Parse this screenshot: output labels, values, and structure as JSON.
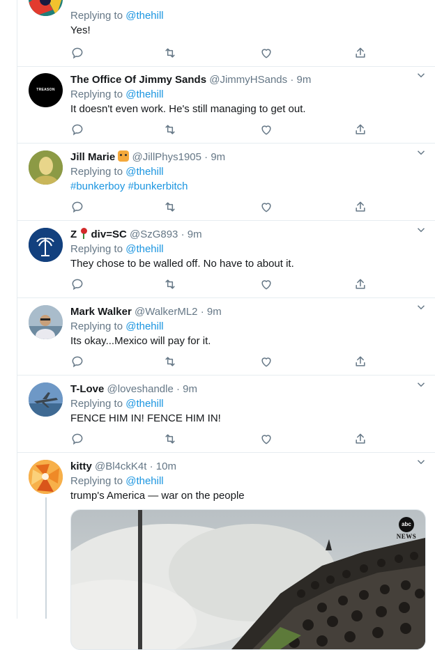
{
  "reply_prefix": "Replying to",
  "tweets": [
    {
      "name": "",
      "handle": "",
      "time": "",
      "mention": "@thehill",
      "text": "Yes!"
    },
    {
      "name": "The Office Of Jimmy Sands",
      "handle": "@JimmyHSands",
      "sep": "·",
      "time": "9m",
      "mention": "@thehill",
      "text": "It doesn't even work.  He's still managing to get out.",
      "avatar_text": "TREASON"
    },
    {
      "name": "Jill Marie",
      "handle": "@JillPhys1905",
      "sep": "·",
      "time": "9m",
      "mention": "@thehill",
      "hashtags": [
        "#bunkerboy",
        "#bunkerbitch"
      ]
    },
    {
      "name_prefix": "Z",
      "name_suffix": "div=SC",
      "handle": "@SzG893",
      "sep": "·",
      "time": "9m",
      "mention": "@thehill",
      "text": "They chose to be walled off. No have to about it."
    },
    {
      "name": "Mark Walker",
      "handle": "@WalkerML2",
      "sep": "·",
      "time": "9m",
      "mention": "@thehill",
      "text": "Its okay...Mexico will pay for it."
    },
    {
      "name": "T-Love",
      "handle": "@loveshandle",
      "sep": "·",
      "time": "9m",
      "mention": "@thehill",
      "text": "FENCE HIM IN! FENCE HIM IN!"
    },
    {
      "name": "kitty",
      "handle": "@Bl4ckK4t",
      "sep": "·",
      "time": "10m",
      "mention": "@thehill",
      "text": "trump's America — war on the people",
      "media_badge_top": "abc",
      "media_badge_bottom": "NEWS"
    }
  ],
  "colors": {
    "link": "#1b95e0",
    "muted": "#657786",
    "border": "#e6ecf0"
  },
  "icons": [
    "reply-icon",
    "retweet-icon",
    "like-icon",
    "share-icon",
    "chevron-down-icon"
  ]
}
